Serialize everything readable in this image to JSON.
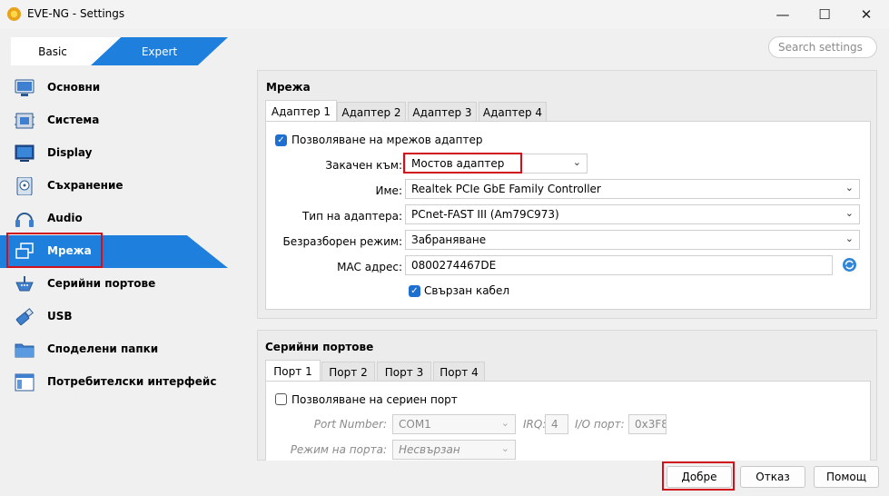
{
  "window": {
    "title": "EVE-NG - Settings",
    "minimize": "—",
    "maximize": "☐",
    "close": "✕"
  },
  "mode": {
    "basic": "Basic",
    "expert": "Expert"
  },
  "search": {
    "placeholder": "Search settings"
  },
  "sidebar": {
    "items": [
      {
        "label": "Основни"
      },
      {
        "label": "Система"
      },
      {
        "label": "Display"
      },
      {
        "label": "Съхранение"
      },
      {
        "label": "Audio"
      },
      {
        "label": "Мрежа"
      },
      {
        "label": "Серийни портове"
      },
      {
        "label": "USB"
      },
      {
        "label": "Споделени папки"
      },
      {
        "label": "Потребителски интерфейс"
      }
    ]
  },
  "network": {
    "title": "Мрежа",
    "tabs": [
      "Адаптер 1",
      "Адаптер 2",
      "Адаптер 3",
      "Адаптер 4"
    ],
    "enable_label": "Позволяване на мрежов адаптер",
    "attached_label": "Закачен към:",
    "attached_value": "Мостов адаптер",
    "name_label": "Име:",
    "name_value": "Realtek PCIe GbE Family Controller",
    "type_label": "Тип на адаптера:",
    "type_value": "PCnet-FAST III (Am79C973)",
    "promisc_label": "Безразборен режим:",
    "promisc_value": "Забраняване",
    "mac_label": "MAC адрес:",
    "mac_value": "0800274467DE",
    "cable_label": "Свързан кабел"
  },
  "serial": {
    "title": "Серийни портове",
    "tabs": [
      "Порт 1",
      "Порт 2",
      "Порт 3",
      "Порт 4"
    ],
    "enable_label": "Позволяване на сериен порт",
    "port_number_label": "Port Number:",
    "port_number_value": "COM1",
    "irq_label": "IRQ:",
    "irq_value": "4",
    "io_label": "I/O порт:",
    "io_value": "0x3F8",
    "mode_label": "Режим на порта:",
    "mode_value": "Несвързан"
  },
  "buttons": {
    "ok": "Добре",
    "cancel": "Отказ",
    "help": "Помощ"
  },
  "colors": {
    "accent": "#1e7fdc",
    "highlight_border": "#d0101b"
  }
}
